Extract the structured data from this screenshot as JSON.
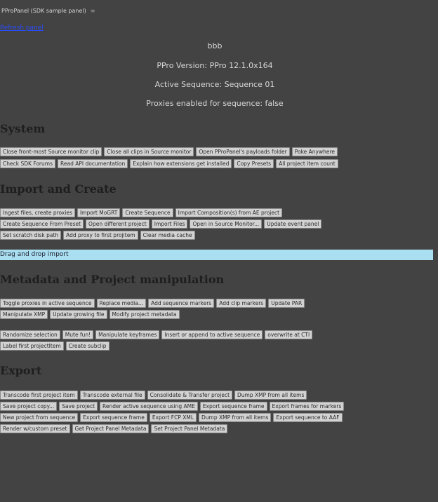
{
  "tab": {
    "title": "PProPanel (SDK sample panel)",
    "menu_glyph": "≡"
  },
  "refresh_link": "Refresh panel",
  "info": {
    "project_name": "bbb",
    "version": "PPro Version: PPro 12.1.0x164",
    "active_sequence": "Active Sequence: Sequence 01",
    "proxies": "Proxies enabled for sequence: false"
  },
  "sections": {
    "system": {
      "title": "System",
      "rows": [
        [
          "Close front-most Source monitor clip",
          "Close all clips in Source monitor",
          "Open PProPanel's payloads folder",
          "Poke Anywhere"
        ],
        [
          "Check SDK Forums",
          "Read API documentation",
          "Explain how extensions get installed",
          "Copy Presets",
          "All project item count"
        ]
      ]
    },
    "import": {
      "title": "Import and Create",
      "rows": [
        [
          "Ingest files, create proxies",
          "Import MoGRT",
          "Create Sequence",
          "Import Composition(s) from AE project"
        ],
        [
          "Create Sequence From Preset",
          "Open different project",
          "Import Files",
          "Open in Source Monitor...",
          "Update event panel"
        ],
        [
          "Set scratch disk path",
          "Add proxy to first projitem",
          "Clear media cache"
        ]
      ]
    },
    "dropzone": "Drag and drop import",
    "metadata": {
      "title": "Metadata and Project manipulation",
      "rows": [
        [
          "Toggle proxies in active sequence",
          "Replace media...",
          "Add sequence markers",
          "Add clip markers",
          "Update PAR"
        ],
        [
          "Manipulate XMP",
          "Update growing file",
          "Modify project metadata"
        ],
        [
          "Randomize selection",
          "Mute fun!",
          "Manipulate keyframes",
          "Insert or append to active sequence",
          "overwrite at CTI"
        ],
        [
          "Label first projectItem",
          "Create subclip"
        ]
      ]
    },
    "export": {
      "title": "Export",
      "rows": [
        [
          "Transcode first project item",
          "Transcode external file",
          "Consolidate & Transfer project",
          "Dump XMP from all items"
        ],
        [
          "Save project copy...",
          "Save project",
          "Render active sequence using AME",
          "Export sequence frame",
          "Export frames for markers"
        ],
        [
          "New project from sequence",
          "Export sequence frame",
          "Export FCP XML",
          "Dump XMP from all items",
          "Export sequence to AAF"
        ],
        [
          "Render w/custom preset",
          "Get Project Panel Metadata",
          "Set Project Panel Metadata"
        ]
      ]
    }
  },
  "colors": {
    "background": "#434343",
    "button": "#d2d2d2",
    "dropzone": "#a9dff0",
    "link": "#2a4cff",
    "heading": "#1e1e1e"
  }
}
